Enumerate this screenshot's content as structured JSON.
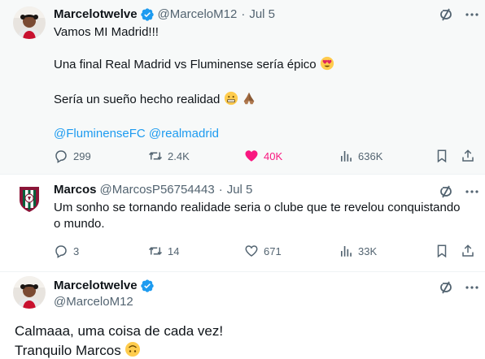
{
  "tweets": [
    {
      "author_name": "Marcelotwelve",
      "handle": "@MarceloM12",
      "dot": "·",
      "date": "Jul 5",
      "lines": [
        "Vamos MI Madrid!!!",
        "Una final Real Madrid vs Fluminense sería épico",
        "Sería un sueño hecho realidad"
      ],
      "mentions": "@FluminenseFC @realmadrid",
      "metrics": {
        "replies": "299",
        "reposts": "2.4K",
        "likes": "40K",
        "views": "636K"
      }
    },
    {
      "author_name": "Marcos",
      "handle": "@MarcosP56754443",
      "dot": "·",
      "date": "Jul 5",
      "lines": [
        "Um sonho se tornando realidade seria o clube que te revelou conquistando",
        "o mundo."
      ],
      "metrics": {
        "replies": "3",
        "reposts": "14",
        "likes": "671",
        "views": "33K"
      }
    },
    {
      "author_name": "Marcelotwelve",
      "handle": "@MarceloM12",
      "lines": [
        "Calmaaa,  uma coisa de cada vez!",
        "Tranquilo Marcos"
      ]
    }
  ],
  "colors": {
    "accent": "#1d9bf0",
    "like": "#f91880",
    "muted": "#536471",
    "text": "#0f1419",
    "highlight_bg": "#f7f9f9"
  },
  "icons": {
    "verified": "verified-badge-icon",
    "grok": "grok-icon",
    "more": "more-icon",
    "reply": "reply-icon",
    "repost": "repost-icon",
    "like": "heart-icon",
    "views": "views-icon",
    "bookmark": "bookmark-icon",
    "share": "share-icon"
  }
}
